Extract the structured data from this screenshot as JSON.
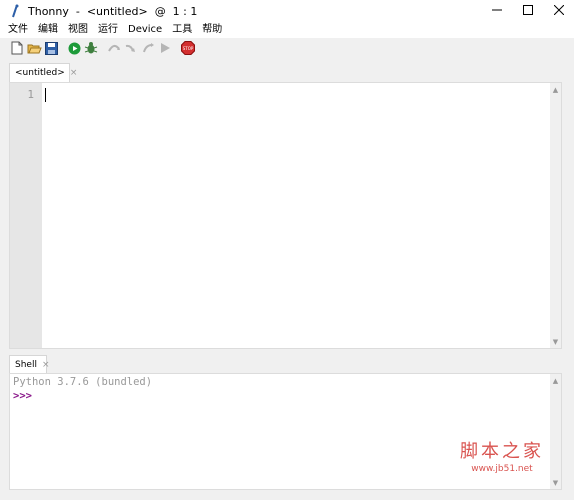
{
  "window": {
    "title": "Thonny  -  <untitled>  @  1 : 1",
    "icons": [
      "thonny-logo-icon",
      "minimize-icon",
      "maximize-icon",
      "close-icon"
    ]
  },
  "menubar": {
    "items": [
      "文件",
      "编辑",
      "视图",
      "运行",
      "Device",
      "工具",
      "帮助"
    ]
  },
  "toolbar": {
    "icons": [
      "new-file-icon",
      "open-file-icon",
      "save-icon",
      "run-icon",
      "debug-icon",
      "step-over-icon",
      "step-into-icon",
      "step-out-icon",
      "resume-icon",
      "stop-icon"
    ],
    "stop_label": "STOP"
  },
  "editor": {
    "tab_label": "<untitled>",
    "tab_close": "×",
    "line_numbers": [
      "1"
    ]
  },
  "shell": {
    "tab_label": "Shell",
    "tab_close": "×",
    "banner": "Python 3.7.6 (bundled)",
    "prompt": ">>>"
  },
  "watermark": {
    "main": "脚本之家",
    "sub": "www.jb51.net"
  },
  "colors": {
    "prompt": "#8b1a8b",
    "run_green": "#1e9b3a",
    "stop_red": "#d32f2f",
    "watermark": "#d9534f"
  }
}
